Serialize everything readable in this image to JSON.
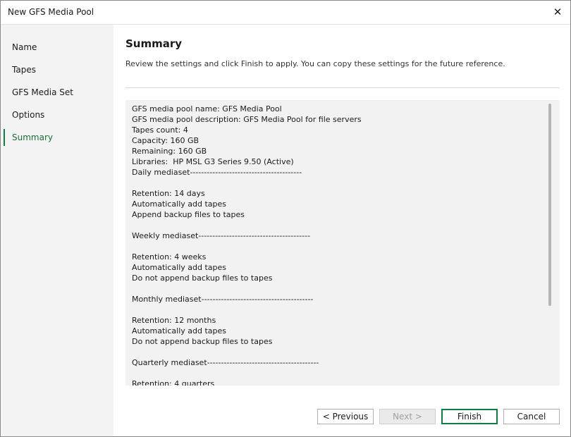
{
  "window": {
    "title": "New GFS Media Pool",
    "close_glyph": "✕"
  },
  "sidebar": {
    "items": [
      {
        "label": "Name",
        "active": false
      },
      {
        "label": "Tapes",
        "active": false
      },
      {
        "label": "GFS Media Set",
        "active": false
      },
      {
        "label": "Options",
        "active": false
      },
      {
        "label": "Summary",
        "active": true
      }
    ]
  },
  "main": {
    "title": "Summary",
    "description": "Review the settings and click Finish to apply. You can copy these settings for the future reference.",
    "summary_text": "GFS media pool name: GFS Media Pool\nGFS media pool description: GFS Media Pool for file servers\nTapes count: 4\nCapacity: 160 GB\nRemaining: 160 GB\nLibraries:  HP MSL G3 Series 9.50 (Active)\nDaily mediaset----------------------------------------\n\nRetention: 14 days\nAutomatically add tapes\nAppend backup files to tapes\n\nWeekly mediaset----------------------------------------\n\nRetention: 4 weeks\nAutomatically add tapes\nDo not append backup files to tapes\n\nMonthly mediaset----------------------------------------\n\nRetention: 12 months\nAutomatically add tapes\nDo not append backup files to tapes\n\nQuarterly mediaset----------------------------------------\n\nRetention: 4 quarters"
  },
  "buttons": {
    "previous": "< Previous",
    "next": "Next >",
    "finish": "Finish",
    "cancel": "Cancel"
  },
  "colors": {
    "accent": "#107c41",
    "sidebar_bg": "#f3f3f3",
    "summary_bg": "#f2f2f2"
  }
}
